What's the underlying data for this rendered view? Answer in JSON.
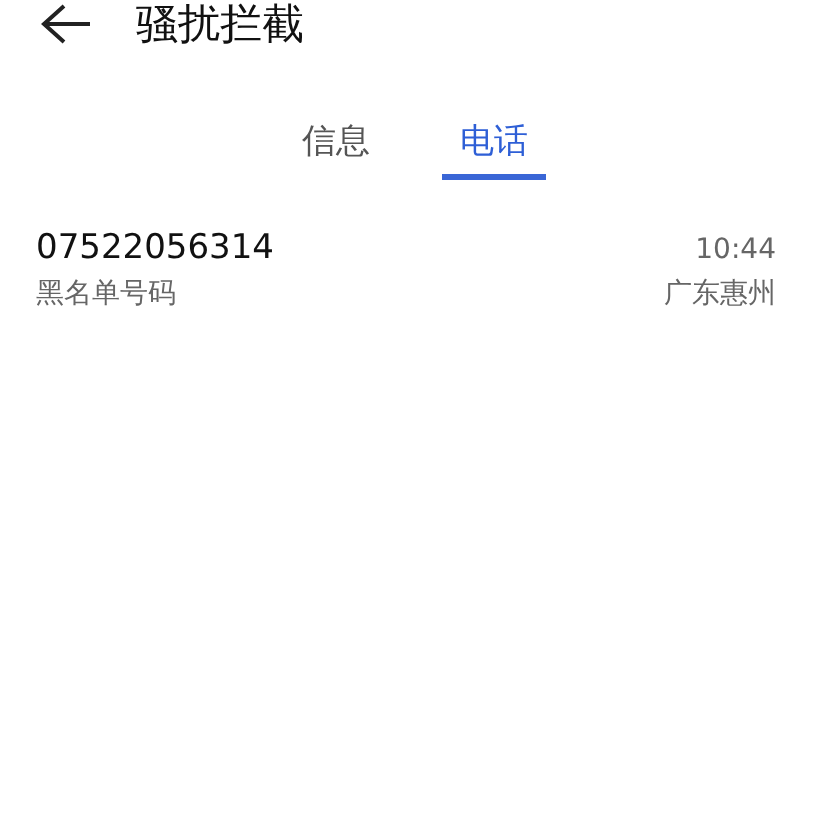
{
  "header": {
    "title": "骚扰拦截"
  },
  "tabs": [
    {
      "label": "信息",
      "selected": false
    },
    {
      "label": "电话",
      "selected": true
    }
  ],
  "calls": [
    {
      "number": "07522056314",
      "note": "黑名单号码",
      "time": "10:44",
      "location": "广东惠州"
    }
  ]
}
